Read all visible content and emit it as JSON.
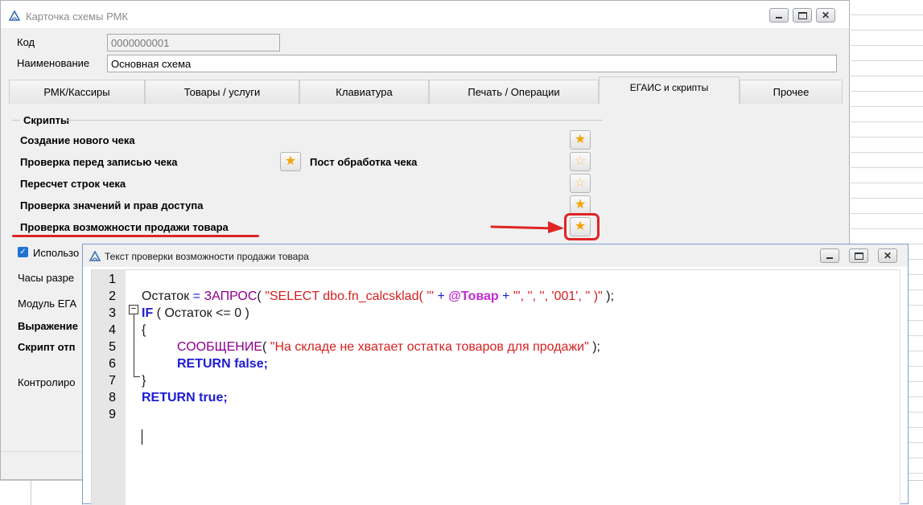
{
  "main_window": {
    "title": "Карточка схемы РМК",
    "fields": {
      "code_label": "Код",
      "code_value": "0000000001",
      "name_label": "Наименование",
      "name_value": "Основная схема"
    },
    "tabs": [
      {
        "label": "РМК/Кассиры",
        "active": false
      },
      {
        "label": "Товары / услуги",
        "active": false
      },
      {
        "label": "Клавиатура",
        "active": false
      },
      {
        "label": "Печать / Операции",
        "active": false
      },
      {
        "label": "ЕГАИС и скрипты",
        "active": true
      },
      {
        "label": "Прочее",
        "active": false
      }
    ],
    "scripts_group": {
      "title": "Скрипты",
      "items": [
        {
          "label": "Создание нового чека",
          "star": "filled"
        },
        {
          "label": "Проверка перед записью чека",
          "star": "filled"
        },
        {
          "label": "Пост обработка чека",
          "star": "empty"
        },
        {
          "label": "Пересчет строк чека",
          "star": "empty"
        },
        {
          "label": "Проверка значений и прав доступа",
          "star": "filled"
        },
        {
          "label": "Проверка возможности продажи товара",
          "star": "filled"
        }
      ]
    },
    "partially_hidden_labels": {
      "use_checkbox": "Использо",
      "hours": "Часы разре",
      "egais_module": "Модуль ЕГА",
      "expression": "Выражение",
      "script": "Скрипт отп",
      "control": "Контролиро"
    }
  },
  "editor_window": {
    "title": "Текст проверки возможности продажи товара",
    "line_numbers": [
      "1",
      "2",
      "3",
      "4",
      "5",
      "6",
      "7",
      "8",
      "9"
    ],
    "code": {
      "l2_var": "Остаток",
      "l2_eq": "=",
      "l2_fn": "ЗАПРОС",
      "l2_p1": "( ",
      "l2_s1": "\"SELECT dbo.fn_calcsklad( '\"",
      "l2_plus1": "+",
      "l2_tovar": "@Товар",
      "l2_plus2": "+",
      "l2_s2": "\"', '', '', '001', '' )\"",
      "l2_end": " );",
      "l3_if": "IF",
      "l3_rest": " ( Остаток <= 0 )",
      "l4": "{",
      "l5_fn": "СООБЩЕНИЕ",
      "l5_p": "( ",
      "l5_s": "\"На складе не хватает остатка товаров для продажи\"",
      "l5_end": " );",
      "l6_kw": "RETURN",
      "l6_val": " false;",
      "l7": "}",
      "l8_kw": "RETURN",
      "l8_val": " true;"
    }
  },
  "colors": {
    "keyword": "#1b1bd4",
    "function": "#8b008b",
    "string": "#d42020",
    "variable": "#c22ad4",
    "annotation_red": "#e02424",
    "star": "#f5a400"
  }
}
